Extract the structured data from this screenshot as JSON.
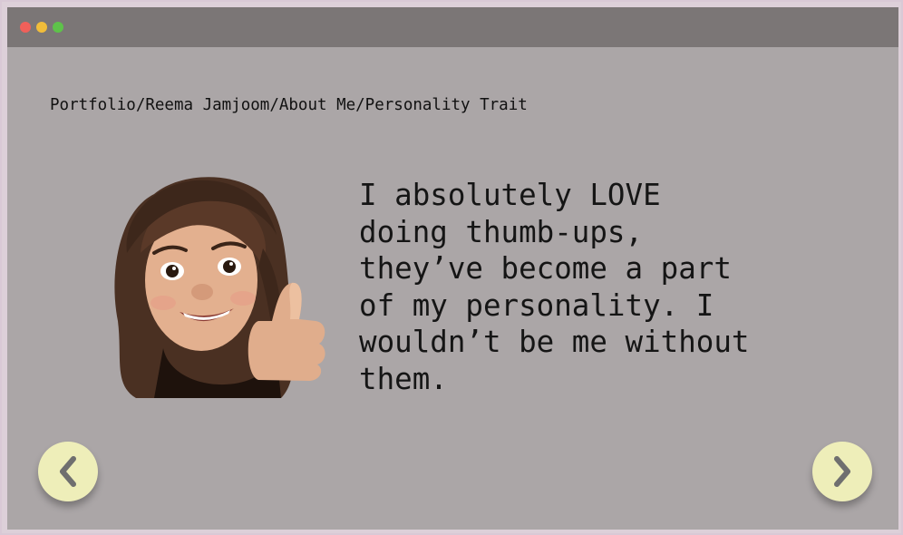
{
  "window": {
    "traffic_lights": [
      "close",
      "minimize",
      "zoom"
    ],
    "colors": {
      "titlebar": "#7b7676",
      "background": "#aba6a7",
      "button": "#eeeeb9"
    }
  },
  "breadcrumb": {
    "text": "Portfolio/Reema Jamjoom/About Me/Personality Trait"
  },
  "main": {
    "avatar_icon": "memoji-thumbs-up-icon",
    "message": "I absolutely LOVE\ndoing thumb-ups,\nthey’ve become a part\nof my personality. I\nwouldn’t be me without\nthem."
  },
  "navigation": {
    "prev_icon": "chevron-left-icon",
    "next_icon": "chevron-right-icon"
  }
}
